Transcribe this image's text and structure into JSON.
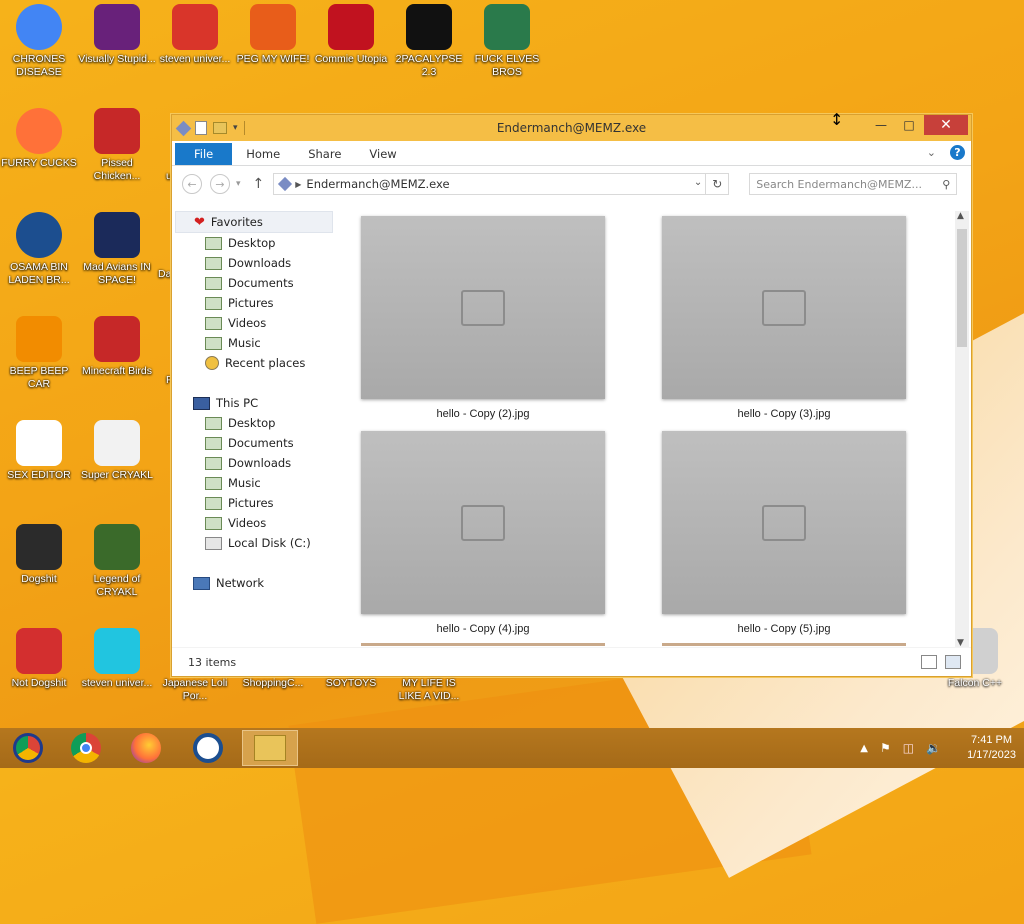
{
  "desktop": {
    "icons": [
      {
        "label": "CHRONES DISEASE",
        "icon": "chrome-icon",
        "color": "#4285f4"
      },
      {
        "label": "Visually Stupid...",
        "icon": "visual-studio-icon",
        "color": "#68217a"
      },
      {
        "label": "steven univer...",
        "icon": "steven-universe-icon",
        "color": "#d9352a"
      },
      {
        "label": "PEG MY WIFE!",
        "icon": "peggle-icon",
        "color": "#e85d1a"
      },
      {
        "label": "Commie Utopia",
        "icon": "commie-icon",
        "color": "#c1121f"
      },
      {
        "label": "2PACALYPSE 2.3",
        "icon": "cmd-icon",
        "color": "#111111"
      },
      {
        "label": "FUCK ELVES BROS",
        "icon": "elf-icon",
        "color": "#2a7a4b"
      },
      {
        "label": "FURRY CUCKS",
        "icon": "firefox-icon",
        "color": "#ff7139"
      },
      {
        "label": "Pissed Chicken...",
        "icon": "angry-birds-seasons-icon",
        "color": "#c62828"
      },
      {
        "label": "OSAMA BIN LADEN BR...",
        "icon": "obama-logo-icon",
        "color": "#1c4e8f"
      },
      {
        "label": "Mad Avians IN SPACE!",
        "icon": "angry-birds-space-icon",
        "color": "#1b2a5a"
      },
      {
        "label": "BEEP BEEP CAR",
        "icon": "vlc-icon",
        "color": "#f28c00"
      },
      {
        "label": "Minecraft Birds",
        "icon": "angry-birds-icon",
        "color": "#c62828"
      },
      {
        "label": "SEX EDITOR",
        "icon": "hxd-icon",
        "color": "#ffffff"
      },
      {
        "label": "Super CRYAKL",
        "icon": "pixel-cat-icon",
        "color": "#f2f2f2"
      },
      {
        "label": "Dogshit",
        "icon": "dogshit-icon",
        "color": "#2b2b2b"
      },
      {
        "label": "Legend of CRYAKL",
        "icon": "pixel-hero-icon",
        "color": "#3a6a2a"
      },
      {
        "label": "Not Dogshit",
        "icon": "devcpp-icon",
        "color": "#d32f2f"
      },
      {
        "label": "steven univer...",
        "icon": "gem-icon",
        "color": "#21c5e0"
      },
      {
        "label": "Japanese Loli Por...",
        "icon": "app-icon",
        "color": "#ef9a14"
      },
      {
        "label": "ShoppingC...",
        "icon": "app-icon",
        "color": "#ef9a14"
      },
      {
        "label": "SOYTOYS",
        "icon": "app-icon",
        "color": "#ef9a14"
      },
      {
        "label": "MY LIFE IS LIKE A VID...",
        "icon": "app-icon",
        "color": "#ef9a14"
      },
      {
        "label": "Falcon C++",
        "icon": "recycle-bin-icon",
        "color": "#d0d0d0"
      }
    ],
    "partial_labels": [
      "Da",
      "u",
      "F"
    ]
  },
  "window": {
    "title": "Endermanch@MEMZ.exe",
    "ribbon_tabs": [
      "File",
      "Home",
      "Share",
      "View"
    ],
    "address": "Endermanch@MEMZ.exe",
    "search_placeholder": "Search Endermanch@MEMZ...",
    "nav": {
      "favorites_label": "Favorites",
      "favorites": [
        "Desktop",
        "Downloads",
        "Documents",
        "Pictures",
        "Videos",
        "Music",
        "Recent places"
      ],
      "thispc_label": "This PC",
      "thispc": [
        "Desktop",
        "Documents",
        "Downloads",
        "Music",
        "Pictures",
        "Videos",
        "Local Disk (C:)"
      ],
      "network_label": "Network"
    },
    "files": [
      {
        "name": "hello - Copy (2).jpg"
      },
      {
        "name": "hello - Copy (3).jpg"
      },
      {
        "name": "hello - Copy (4).jpg"
      },
      {
        "name": "hello - Copy (5).jpg"
      }
    ],
    "status": "13 items"
  },
  "taskbar": {
    "time": "7:41 PM",
    "date": "1/17/2023"
  }
}
